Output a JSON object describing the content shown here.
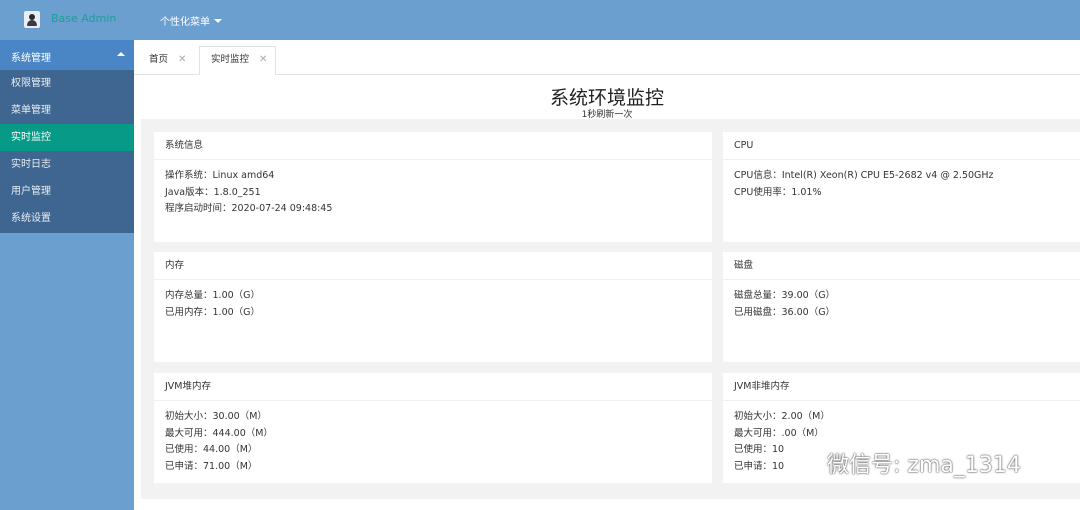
{
  "app": {
    "title": "Base Admin",
    "top_menu": "个性化菜单"
  },
  "sidebar": {
    "group": "系统管理",
    "items": [
      {
        "label": "权限管理"
      },
      {
        "label": "菜单管理"
      },
      {
        "label": "实时监控"
      },
      {
        "label": "实时日志"
      },
      {
        "label": "用户管理"
      },
      {
        "label": "系统设置"
      }
    ],
    "active_index": 2
  },
  "tabs": [
    {
      "label": "首页"
    },
    {
      "label": "实时监控"
    }
  ],
  "main": {
    "title": "系统环境监控",
    "subtitle": "1秒刷新一次"
  },
  "cards": {
    "system": {
      "title": "系统信息",
      "rows": [
        "操作系统：Linux amd64",
        "Java版本：1.8.0_251",
        "程序启动时间：2020-07-24 09:48:45"
      ]
    },
    "cpu": {
      "title": "CPU",
      "rows": [
        "CPU信息：Intel(R) Xeon(R) CPU E5-2682 v4 @ 2.50GHz",
        "CPU使用率：1.01%"
      ]
    },
    "memory": {
      "title": "内存",
      "rows": [
        "内存总量：1.00（G）",
        "已用内存：1.00（G）"
      ]
    },
    "disk": {
      "title": "磁盘",
      "rows": [
        "磁盘总量：39.00（G）",
        "已用磁盘：36.00（G）"
      ]
    },
    "jvm_heap": {
      "title": "JVM堆内存",
      "rows": [
        "初始大小：30.00（M）",
        "最大可用：444.00（M）",
        "已使用：44.00（M）",
        "已申请：71.00（M）"
      ]
    },
    "jvm_nonheap": {
      "title": "JVM非堆内存",
      "rows": [
        "初始大小：2.00（M）",
        "最大可用：.00（M）",
        "已使用：10",
        "已申请：10"
      ]
    }
  },
  "watermark": {
    "text": "微信号: zma_1314"
  },
  "colors": {
    "header_bg": "#6a9fd0",
    "sidebar_group_bg": "#4a86c5",
    "sidebar_list_bg": "#3e6690",
    "active_item_bg": "#079a87",
    "brand_text": "#1e9e9a"
  }
}
